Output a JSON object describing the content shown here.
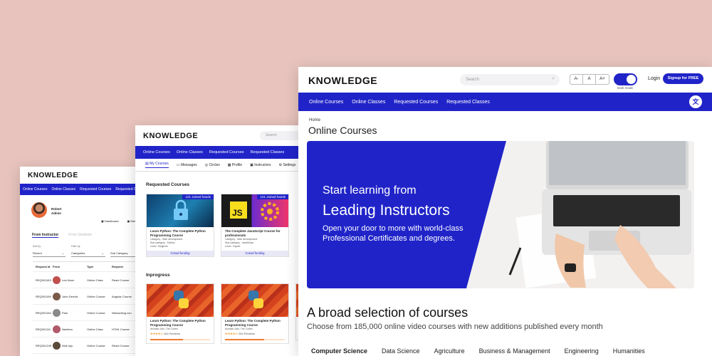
{
  "w1": {
    "brand": "KNOWLEDGE",
    "nav": [
      "Online Courses",
      "Online Classes",
      "Requested Courses",
      "Requested Classes"
    ],
    "profile": {
      "name": "Robert",
      "role": "Admin"
    },
    "links": [
      "Dashboard",
      "Messages"
    ],
    "tabs": {
      "active": "From Instructor",
      "inactive": "From Students"
    },
    "filters": [
      {
        "label": "Sort by",
        "value": "Recent"
      },
      {
        "label": "Filter by",
        "value": "Categories"
      },
      {
        "label": "",
        "value": "Sub Category"
      }
    ],
    "table": {
      "headers": [
        "Request Id",
        "From",
        "Type",
        "Request"
      ],
      "rows": [
        {
          "id": "REQ001163",
          "from": "Lea Nunn",
          "type": "Online Class",
          "req": "React Course"
        },
        {
          "id": "REQ001159",
          "from": "John Derrick",
          "type": "Online Course",
          "req": "Angular Course"
        },
        {
          "id": "REQ001154",
          "from": "Paul",
          "type": "Online Course",
          "req": "Networking cou"
        },
        {
          "id": "REQ001111",
          "from": "Neelima",
          "type": "Online Class",
          "req": "HTML Course"
        },
        {
          "id": "REQ001249",
          "from": "Nick Ioju",
          "type": "Online Course",
          "req": "React Course"
        }
      ]
    }
  },
  "w2": {
    "brand": "KNOWLEDGE",
    "search": "Search",
    "nav": [
      "Online Courses",
      "Online Classes",
      "Requested Courses",
      "Requested Classes"
    ],
    "tabs": [
      "My Courses",
      "Messages",
      "Circles",
      "Profile",
      "Instructors",
      "Settings"
    ],
    "requested_title": "Requested Courses",
    "requested": [
      {
        "joined": "121 Joined hands",
        "title": "Learn Python: The Complete Python Programming Course",
        "meta": [
          "Category : Web development",
          "Sub-category : Python",
          "Level : Beginner"
        ],
        "action": "Crowd funding"
      },
      {
        "joined": "121 Joined hands",
        "title": "The Complete JavaScript Course for professionals",
        "meta": [
          "Category : Web development",
          "Sub-category : JavaScript",
          "Level : Expert"
        ],
        "action": "Crowd funding"
      }
    ],
    "inprogress_title": "Inprogress",
    "inprogress": [
      {
        "title": "Learn Python: The Complete Python Programming Course",
        "author": "Avinash Jain, The Codex",
        "stars": "★★★★☆",
        "reviews": "264 Reviews",
        "progress": 0.55
      },
      {
        "title": "Learn Python: The Complete Python Programming Course",
        "author": "Avinash Jain, The Codex",
        "stars": "★★★★☆",
        "reviews": "264 Reviews",
        "progress": 0.65
      }
    ]
  },
  "w3": {
    "brand": "KNOWLEDGE",
    "search_placeholder": "Search",
    "font_sizes": [
      "A-",
      "A",
      "A+"
    ],
    "dark_mode": "Dark mode",
    "login": "Login",
    "signup": "Signup for FREE",
    "nav": [
      "Online Courses",
      "Online Classes",
      "Requested Courses",
      "Requested Classes"
    ],
    "breadcrumb": "Home",
    "page_title": "Online Courses",
    "hero": {
      "line1": "Start learning from",
      "line2": "Leading Instructors",
      "line3": "Open your door to more with world-class Professional Certificates and degrees."
    },
    "section_title": "A broad selection of courses",
    "section_sub": "Choose from 185,000 online video courses with new additions published every month",
    "categories": [
      "Computer Science",
      "Data Science",
      "Agriculture",
      "Business & Management",
      "Engineering",
      "Humanities"
    ]
  },
  "colors": {
    "brand_blue": "#2024c8",
    "background": "#e8c3bd",
    "accent_orange": "#f07a2d"
  }
}
